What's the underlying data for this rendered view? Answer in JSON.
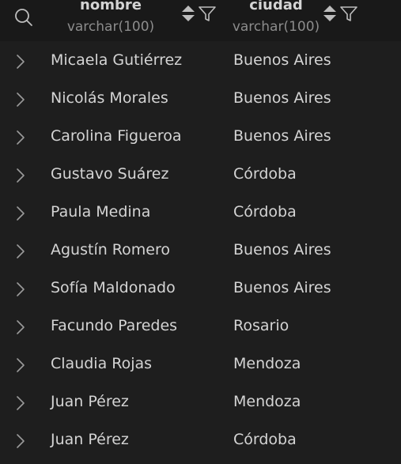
{
  "header": {
    "columns": [
      {
        "name": "nombre",
        "type": "varchar(100)"
      },
      {
        "name": "ciudad",
        "type": "varchar(100)"
      }
    ],
    "icons": {
      "search": "search-icon",
      "sort": "sort-icon",
      "filter": "filter-icon",
      "expand": "chevron-right-icon"
    }
  },
  "rows": [
    {
      "nombre": "Micaela Gutiérrez",
      "ciudad": "Buenos Aires"
    },
    {
      "nombre": "Nicolás Morales",
      "ciudad": "Buenos Aires"
    },
    {
      "nombre": "Carolina Figueroa",
      "ciudad": "Buenos Aires"
    },
    {
      "nombre": "Gustavo Suárez",
      "ciudad": "Córdoba"
    },
    {
      "nombre": "Paula Medina",
      "ciudad": "Córdoba"
    },
    {
      "nombre": "Agustín Romero",
      "ciudad": "Buenos Aires"
    },
    {
      "nombre": "Sofía Maldonado",
      "ciudad": "Buenos Aires"
    },
    {
      "nombre": "Facundo Paredes",
      "ciudad": "Rosario"
    },
    {
      "nombre": "Claudia Rojas",
      "ciudad": "Mendoza"
    },
    {
      "nombre": "Juan Pérez",
      "ciudad": "Mendoza"
    },
    {
      "nombre": "Juan Pérez",
      "ciudad": "Córdoba"
    }
  ],
  "colors": {
    "background": "#1e1e1e",
    "header_background": "#191919",
    "text": "#d4d4d4",
    "muted_text": "#8c8c8c",
    "icon": "#bdbdbd"
  }
}
